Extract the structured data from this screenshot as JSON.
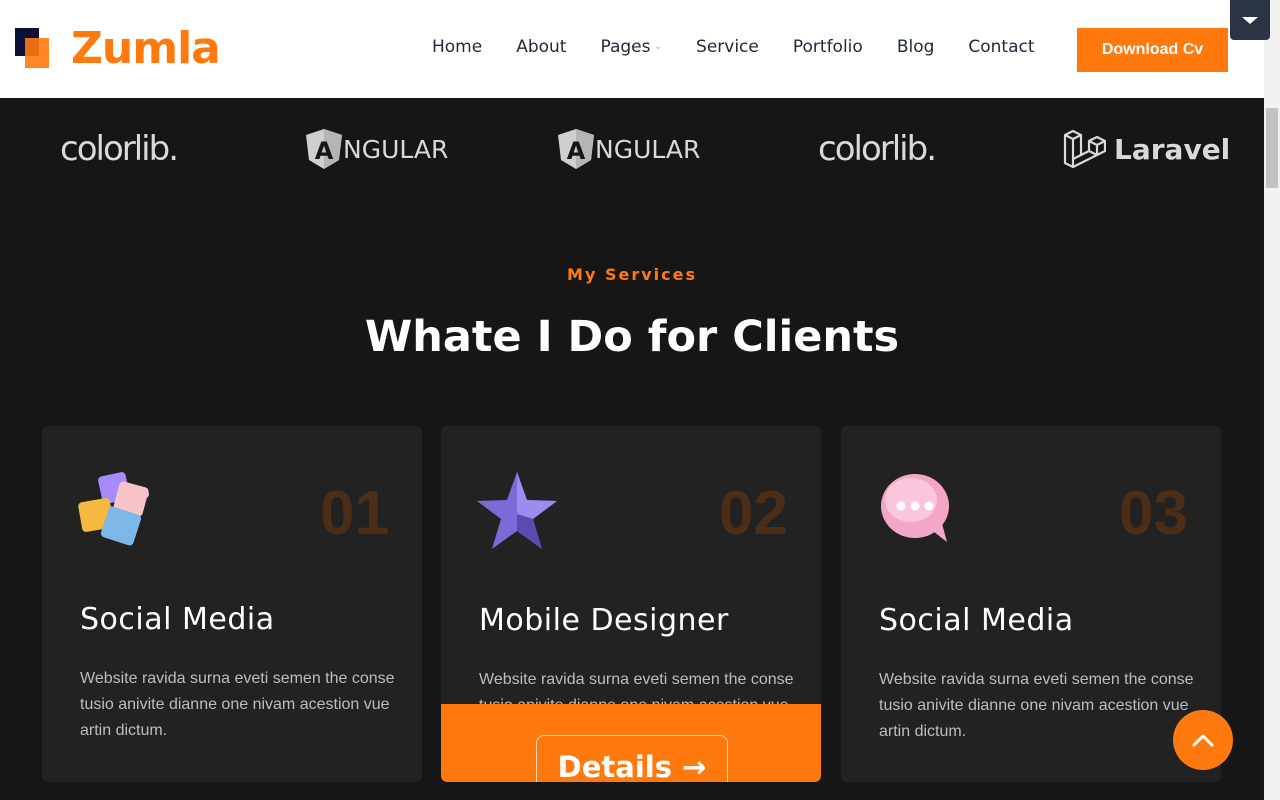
{
  "header": {
    "logo_text": "Zumla",
    "nav": [
      {
        "label": "Home"
      },
      {
        "label": "About"
      },
      {
        "label": "Pages"
      },
      {
        "label": "Service"
      },
      {
        "label": "Portfolio"
      },
      {
        "label": "Blog"
      },
      {
        "label": "Contact"
      }
    ],
    "download_label": "Download Cv"
  },
  "brands": [
    {
      "name": "colorlib."
    },
    {
      "name": "NGULAR"
    },
    {
      "name": "NGULAR"
    },
    {
      "name": "colorlib."
    },
    {
      "name": "Laravel"
    }
  ],
  "services": {
    "eyebrow": "My Services",
    "title": "Whate I Do for Clients",
    "cards": [
      {
        "num": "01",
        "title": "Social Media",
        "desc": "Website ravida surna eveti semen the conse tusio anivite dianne one nivam acestion vue artin dictum.",
        "icon": "puzzle-icon"
      },
      {
        "num": "02",
        "title": "Mobile Designer",
        "desc": "Website ravida surna eveti semen the conse tusio anivite dianne one nivam acestion vue artin dictum.",
        "icon": "star-icon",
        "details_label": "Details →"
      },
      {
        "num": "03",
        "title": "Social Media",
        "desc": "Website ravida surna eveti semen the conse tusio anivite dianne one nivam acestion vue artin dictum.",
        "icon": "chat-bubble-icon"
      }
    ]
  },
  "colors": {
    "accent": "#ff7a0e",
    "background": "#161616",
    "card": "#222222",
    "nav_text": "#1f2937"
  }
}
